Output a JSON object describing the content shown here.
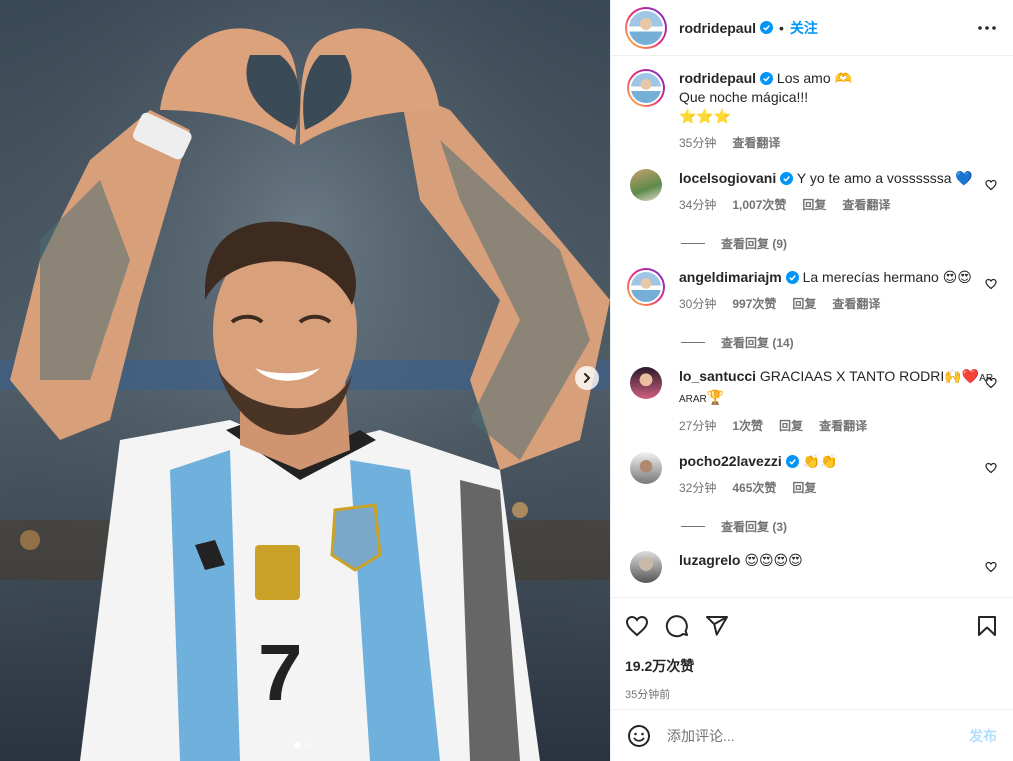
{
  "post": {
    "username": "rodridepaul",
    "follow_label": "关注",
    "separator": "•",
    "caption_line1": "Los amo 🫶",
    "caption_line2": "Que noche mágica!!!",
    "caption_line3": "⭐⭐⭐",
    "caption_time": "35分钟",
    "see_translation": "查看翻译",
    "likes": "19.2万次赞",
    "posted_ago": "35分钟前",
    "add_comment_placeholder": "添加评论...",
    "post_button": "发布",
    "image_alt": "Player in Argentina jersey number 7 making a heart sign with hands",
    "carousel_index": 1,
    "carousel_total": 2
  },
  "comments": [
    {
      "username": "locelsogiovani",
      "verified": true,
      "text": "Y yo te amo a vossssssa 💙",
      "time": "34分钟",
      "likes": "1,007次赞",
      "reply": "回复",
      "translate": "查看翻译",
      "view_replies": "查看回复 (9)"
    },
    {
      "username": "angeldimariajm",
      "verified": true,
      "text": "La merecías hermano 😍😍",
      "time": "30分钟",
      "likes": "997次赞",
      "reply": "回复",
      "translate": "查看翻译",
      "view_replies": "查看回复 (14)"
    },
    {
      "username": "lo_santucci",
      "verified": false,
      "text": "GRACIAAS X TANTO RODRI🙌❤️",
      "text_small": "AR ARAR",
      "trophy": "🏆",
      "time": "27分钟",
      "likes": "1次赞",
      "reply": "回复",
      "translate": "查看翻译"
    },
    {
      "username": "pocho22lavezzi",
      "verified": true,
      "text": "👏👏",
      "time": "32分钟",
      "likes": "465次赞",
      "reply": "回复",
      "view_replies": "查看回复 (3)"
    },
    {
      "username": "luzagrelo",
      "verified": false,
      "text": "😍😍😍😍"
    }
  ],
  "colors": {
    "accent": "#0095f6",
    "verified": "#0095f6",
    "muted": "#737373"
  },
  "icons": [
    "heart-icon",
    "comment-icon",
    "share-icon",
    "bookmark-icon",
    "more-icon",
    "emoji-icon",
    "next-arrow-icon",
    "verified-icon"
  ]
}
